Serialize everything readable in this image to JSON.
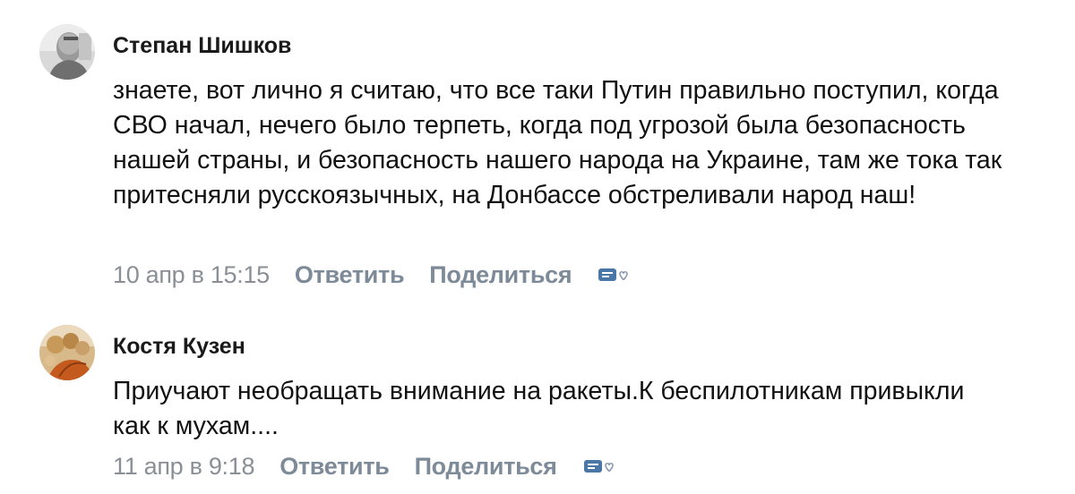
{
  "comments": [
    {
      "author": "Степан Шишков",
      "text": "знаете, вот лично я считаю, что все таки Путин правильно поступил, когда СВО начал, нечего было терпеть, когда под угрозой была безопасность нашей страны, и безопасность нашего народа на Украине, там же тока так притесняли русскоязычных, на Донбассе обстреливали народ наш!",
      "date": "10 апр в 15:15",
      "reply_label": "Ответить",
      "share_label": "Поделиться",
      "reaction_icon": "like-reaction-icon"
    },
    {
      "author": "Костя Кузен",
      "text": "Приучают необращать внимание на ракеты.К беспилотникам привыкли как к мухам....",
      "date": "11 апр в 9:18",
      "reply_label": "Ответить",
      "share_label": "Поделиться",
      "reaction_icon": "like-reaction-icon"
    }
  ],
  "colors": {
    "text": "#111111",
    "meta": "#8a8f96",
    "action": "#7d8a98",
    "icon_blue": "#4a76a8"
  }
}
